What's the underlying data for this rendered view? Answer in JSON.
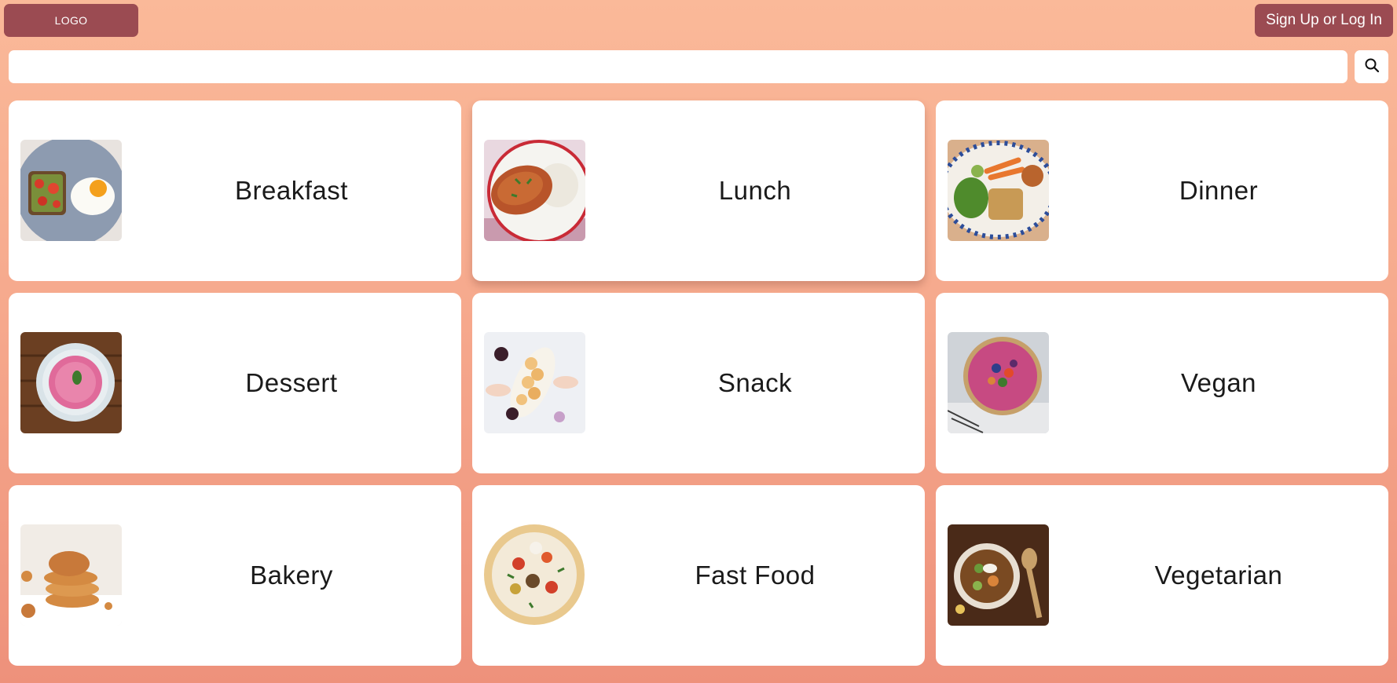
{
  "header": {
    "logo_text": "LOGO",
    "auth_label": "Sign Up or Log In",
    "brand_color": "#9b4b52"
  },
  "search": {
    "placeholder": "",
    "value": "",
    "icon": "search-icon"
  },
  "categories": [
    {
      "label": "Breakfast",
      "image": "avocado-toast-egg-photo"
    },
    {
      "label": "Lunch",
      "image": "omelette-rice-photo"
    },
    {
      "label": "Dinner",
      "image": "platter-salad-photo"
    },
    {
      "label": "Dessert",
      "image": "pink-smoothie-bowl-photo"
    },
    {
      "label": "Snack",
      "image": "cheese-platter-photo"
    },
    {
      "label": "Vegan",
      "image": "berry-tart-photo"
    },
    {
      "label": "Bakery",
      "image": "cookies-stack-photo"
    },
    {
      "label": "Fast Food",
      "image": "pizza-photo"
    },
    {
      "label": "Vegetarian",
      "image": "vegetable-stew-photo"
    }
  ]
}
